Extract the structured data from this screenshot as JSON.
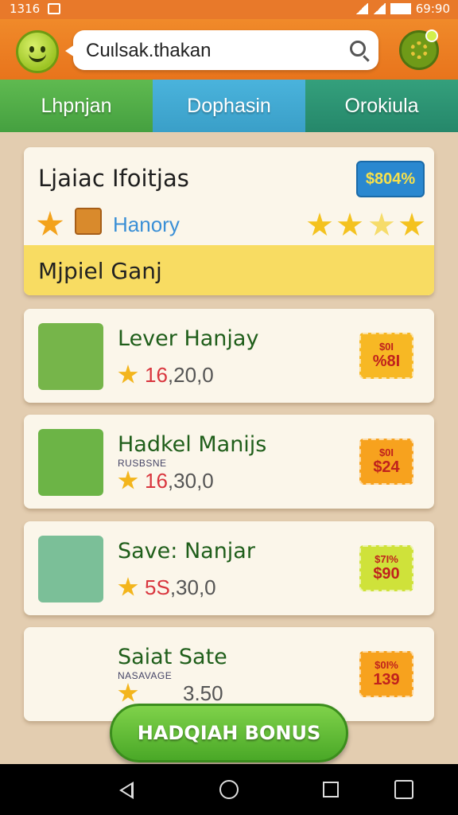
{
  "status": {
    "time": "1316",
    "right_text": "69:90"
  },
  "header": {
    "search_query": "Cuιlsak.thakan"
  },
  "tabs": [
    {
      "label": "Lhpnjan"
    },
    {
      "label": "Dophasin"
    },
    {
      "label": "Orokiula"
    }
  ],
  "featured": {
    "title": "Ljaiac Ifoitjas",
    "price": "$804%",
    "subtitle": "Hanory",
    "stars": 4,
    "banner": "Mjpiel Ganj"
  },
  "items": [
    {
      "name": "Lever Hanjay",
      "small": "",
      "score_red": "16",
      "score_rest": ",20,0",
      "tag_top": "$0I",
      "tag_bottom": "%8I",
      "colors": {
        "tag": "#f7b824",
        "thumb": "#76b54a"
      }
    },
    {
      "name": "Hadkel Manijs",
      "small": "RUSBSNE",
      "score_red": "16",
      "score_rest": ",30,0",
      "tag_top": "$0I",
      "tag_bottom": "$24",
      "colors": {
        "tag": "#f7a21e",
        "thumb": "#6cb446"
      }
    },
    {
      "name": "Save: Nanjar",
      "small": "",
      "score_red": "5S",
      "score_rest": ",30,0",
      "tag_top": "$7I%",
      "tag_bottom": "$90",
      "colors": {
        "tag": "#cfe23a",
        "thumb": "#7bbf98"
      }
    },
    {
      "name": "Saiat Sate",
      "small": "NASAVAGE",
      "score_red": "",
      "score_rest": "3.50",
      "tag_top": "$0I%",
      "tag_bottom": "139",
      "colors": {
        "tag": "#f7a21e",
        "thumb": "#fbf6ea"
      }
    }
  ],
  "bonus_button": "HADQIAH BONUS"
}
